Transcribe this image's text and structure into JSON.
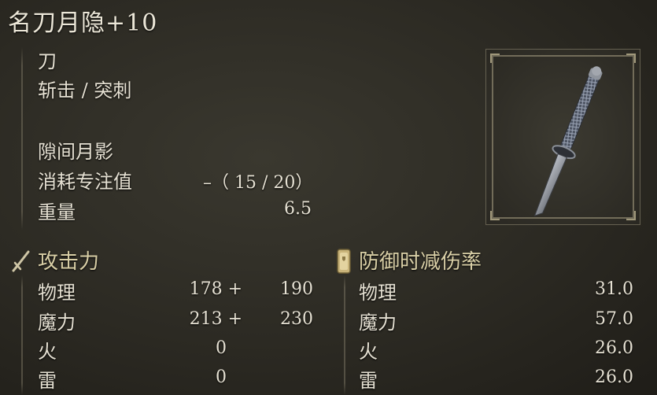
{
  "weapon": {
    "name": "名刀月隐+10",
    "type": "刀",
    "attack_type": "斩击 / 突刺",
    "skill": "隙间月影",
    "fp_cost_label": "消耗专注值",
    "fp_cost_value": "–（ 15 / 20）",
    "weight_label": "重量",
    "weight_value": "6.5"
  },
  "attack": {
    "heading": "攻击力",
    "icon": "sword-icon",
    "rows": [
      {
        "label": "物理",
        "base": "178 +",
        "total": "190"
      },
      {
        "label": "魔力",
        "base": "213 +",
        "total": "230"
      },
      {
        "label": "火",
        "base": "0",
        "total": ""
      },
      {
        "label": "雷",
        "base": "0",
        "total": ""
      }
    ]
  },
  "guard": {
    "heading": "防御时减伤率",
    "icon": "shield-icon",
    "rows": [
      {
        "label": "物理",
        "value": "31.0"
      },
      {
        "label": "魔力",
        "value": "57.0"
      },
      {
        "label": "火",
        "value": "26.0"
      },
      {
        "label": "雷",
        "value": "26.0"
      }
    ]
  },
  "colors": {
    "heading": "#d9cfa6",
    "text": "#e6e1d3",
    "background": "#2c2a23"
  }
}
